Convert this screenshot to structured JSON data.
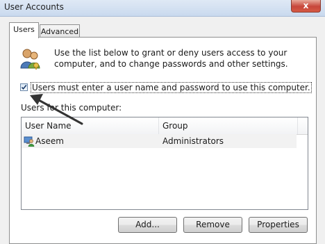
{
  "window": {
    "title": "User Accounts",
    "close_label": "x"
  },
  "tabs": [
    {
      "label": "Users"
    },
    {
      "label": "Advanced"
    }
  ],
  "intro": {
    "description": "Use the list below to grant or deny users access to your computer, and to change passwords and other settings."
  },
  "require_password": {
    "label": "Users must enter a user name and password to use this computer.",
    "checked": true
  },
  "users_list": {
    "label": "Users for this computer:",
    "columns": [
      "User Name",
      "Group"
    ],
    "rows": [
      {
        "user_name": "Aseem",
        "group": "Administrators"
      }
    ]
  },
  "buttons": {
    "add": "Add...",
    "remove": "Remove",
    "properties": "Properties"
  },
  "colors": {
    "titlebar": "#c9d9ee",
    "close_button": "#c7463a",
    "arrow": "#333333"
  }
}
